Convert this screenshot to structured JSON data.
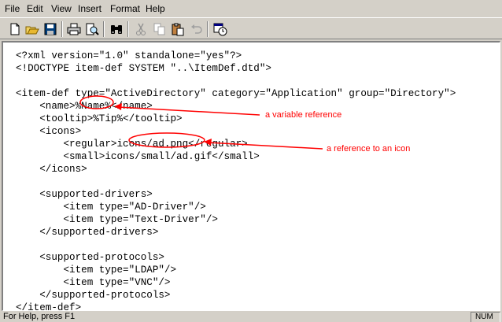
{
  "menu": [
    "File",
    "Edit",
    "View",
    "Insert",
    "Format",
    "Help"
  ],
  "toolbar": {
    "buttons": [
      {
        "name": "new-button",
        "icon": "new-document-icon"
      },
      {
        "name": "open-button",
        "icon": "open-folder-icon"
      },
      {
        "name": "save-button",
        "icon": "save-disk-icon"
      },
      {
        "name": "print-button",
        "icon": "printer-icon"
      },
      {
        "name": "print-preview-button",
        "icon": "print-preview-icon"
      },
      {
        "name": "find-button",
        "icon": "binoculars-icon"
      },
      {
        "name": "cut-button",
        "icon": "scissors-icon",
        "disabled": true
      },
      {
        "name": "copy-button",
        "icon": "copy-icon",
        "disabled": true
      },
      {
        "name": "paste-button",
        "icon": "paste-clipboard-icon"
      },
      {
        "name": "undo-button",
        "icon": "undo-icon",
        "disabled": true
      },
      {
        "name": "date-time-button",
        "icon": "date-time-icon"
      }
    ]
  },
  "document": {
    "lines": [
      "<?xml version=\"1.0\" standalone=\"yes\"?>",
      "<!DOCTYPE item-def SYSTEM \"..\\ItemDef.dtd\">",
      "",
      "<item-def type=\"ActiveDirectory\" category=\"Application\" group=\"Directory\">",
      "    <name>%Name%</name>",
      "    <tooltip>%Tip%</tooltip>",
      "    <icons>",
      "        <regular>icons/ad.png</regular>",
      "        <small>icons/small/ad.gif</small>",
      "    </icons>",
      "",
      "    <supported-drivers>",
      "        <item type=\"AD-Driver\"/>",
      "        <item type=\"Text-Driver\"/>",
      "    </supported-drivers>",
      "",
      "    <supported-protocols>",
      "        <item type=\"LDAP\"/>",
      "        <item type=\"VNC\"/>",
      "    </supported-protocols>",
      "</item-def>"
    ]
  },
  "annotations": {
    "variable_reference": "a variable reference",
    "icon_reference": "a reference to an icon",
    "color": "#ff0000"
  },
  "statusbar": {
    "text": "For Help, press F1",
    "num": "NUM"
  }
}
